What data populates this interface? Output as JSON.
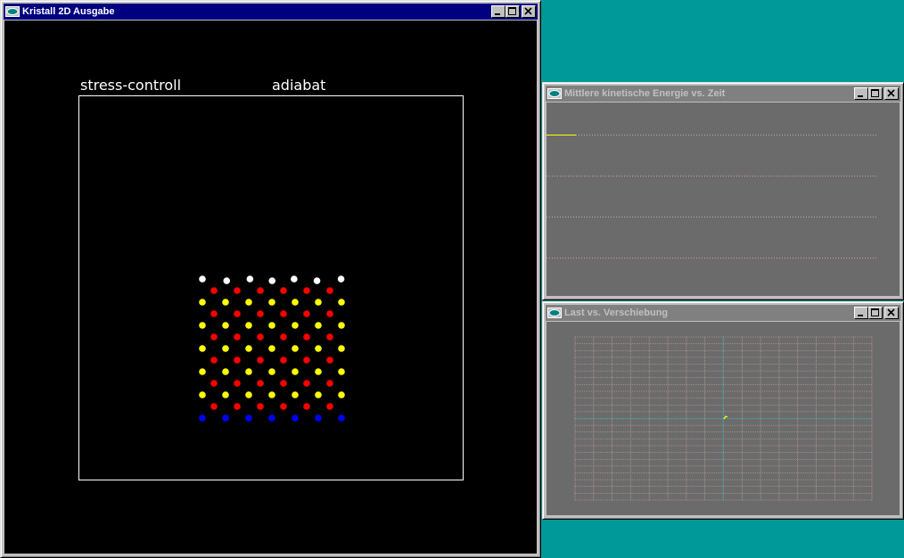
{
  "windows": {
    "crystal": {
      "title": "Kristall 2D Ausgabe"
    },
    "energy": {
      "title": "Mittlere kinetische Energie vs. Zeit"
    },
    "load": {
      "title": "Last vs. Verschiebung"
    }
  },
  "crystal_view": {
    "mode_label": "stress-controll",
    "thermo_label": "adiabat",
    "colors": {
      "white": "#ffffff",
      "red": "#ff0000",
      "yellow": "#ffff00",
      "blue": "#0000ff",
      "background": "#000000",
      "box": "#ffffff"
    },
    "rows": [
      "white",
      "red",
      "yellow",
      "red",
      "yellow",
      "red",
      "yellow",
      "red",
      "yellow",
      "red",
      "yellow",
      "red",
      "blue"
    ]
  },
  "energy_plot": {
    "background": "#6b6b6b",
    "grid_color": "#d8a0a0",
    "trace_color": "#ffff00"
  },
  "load_plot": {
    "background": "#6b6b6b",
    "grid_color": "#e0a8a8",
    "axis_color": "#00c0c0",
    "marker_color": "#ffff00"
  }
}
